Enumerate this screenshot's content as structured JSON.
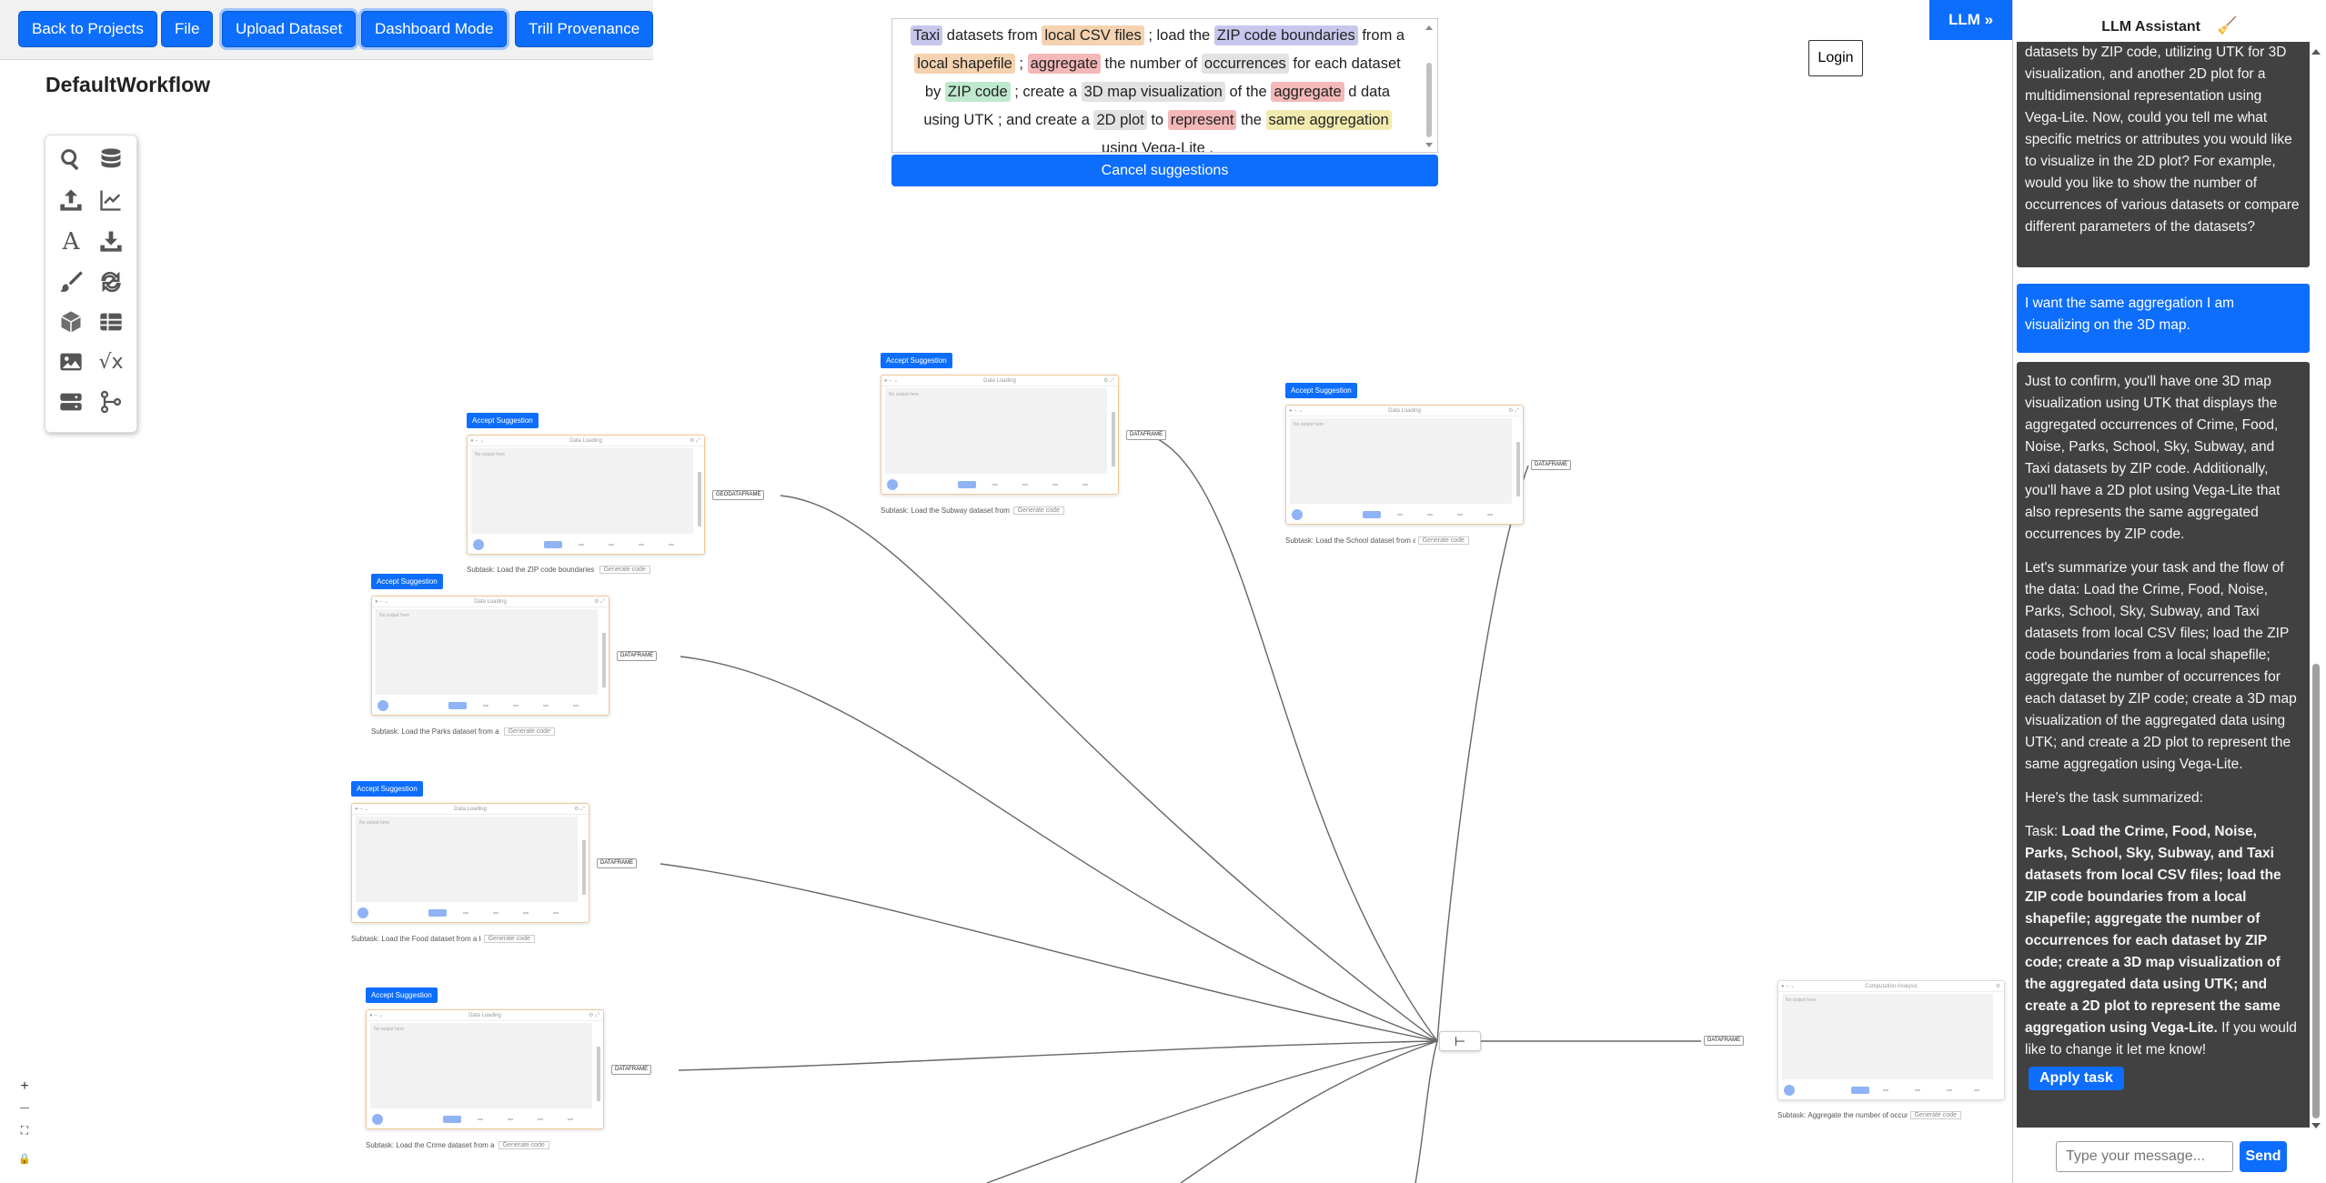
{
  "toolbar": {
    "back_label": "Back to Projects",
    "file_label": "File",
    "upload_label": "Upload Dataset",
    "dashboard_label": "Dashboard Mode",
    "provenance_label": "Trill Provenance"
  },
  "workflow_title": "DefaultWorkflow",
  "palette_icons": [
    "search-data-icon",
    "database-icon",
    "upload-icon",
    "line-chart-icon",
    "text-icon",
    "download-icon",
    "brush-icon",
    "loop-icon",
    "cube-icon",
    "table-icon",
    "image-icon",
    "formula-icon",
    "server-icon",
    "merge-flow-icon"
  ],
  "suggestion": {
    "tokens": [
      {
        "t": "Taxi",
        "c": "blue"
      },
      {
        "t": " datasets from "
      },
      {
        "t": "local CSV files",
        "c": "orange"
      },
      {
        "t": " ; load the "
      },
      {
        "t": "ZIP code boundaries",
        "c": "blue"
      },
      {
        "t": " from a "
      },
      {
        "t": "local shapefile",
        "c": "orange"
      },
      {
        "t": " ; "
      },
      {
        "t": "aggregate",
        "c": "pink"
      },
      {
        "t": " the number of "
      },
      {
        "t": "occurrences",
        "c": "gray"
      },
      {
        "t": " for each dataset by "
      },
      {
        "t": "ZIP code",
        "c": "green"
      },
      {
        "t": " ; create a "
      },
      {
        "t": "3D map visualization",
        "c": "gray"
      },
      {
        "t": " of the "
      },
      {
        "t": "aggregate",
        "c": "pink"
      },
      {
        "t": " d data using "
      },
      {
        "t": "UTK",
        "c": ""
      },
      {
        "t": " ; and create a "
      },
      {
        "t": "2D plot",
        "c": "gray"
      },
      {
        "t": " to "
      },
      {
        "t": "represent",
        "c": "pink"
      },
      {
        "t": " the "
      },
      {
        "t": "same aggregation",
        "c": "yellow"
      },
      {
        "t": " using "
      },
      {
        "t": "Vega-Lite",
        "c": ""
      },
      {
        "t": " ."
      }
    ],
    "cancel_label": "Cancel suggestions"
  },
  "login_label": "Login",
  "llm_toggle_label": "LLM »",
  "nodes": [
    {
      "id": "zip",
      "accept": "Accept Suggestion",
      "header": "Data Loading",
      "body": "No output here",
      "subtask_prefix": "Subtask:",
      "subtask": "Load the ZIP code boundaries from a local shapefile",
      "gen": "Generate code",
      "out": "GEODATAFRAME"
    },
    {
      "id": "subway",
      "accept": "Accept Suggestion",
      "header": "Data Loading",
      "body": "No output here",
      "subtask_prefix": "Subtask:",
      "subtask": "Load the Subway dataset from a local CSV file",
      "gen": "Generate code",
      "out": "DATAFRAME"
    },
    {
      "id": "school",
      "accept": "Accept Suggestion",
      "header": "Data Loading",
      "body": "No output here",
      "subtask_prefix": "Subtask:",
      "subtask": "Load the School dataset from a local CSV file",
      "gen": "Generate code",
      "out": "DATAFRAME"
    },
    {
      "id": "parks",
      "accept": "Accept Suggestion",
      "header": "Data Loading",
      "body": "No output here",
      "subtask_prefix": "Subtask:",
      "subtask": "Load the Parks dataset from a local CSV file",
      "gen": "Generate code",
      "out": "DATAFRAME"
    },
    {
      "id": "food",
      "accept": "Accept Suggestion",
      "header": "Data Loading",
      "body": "No output here",
      "subtask_prefix": "Subtask:",
      "subtask": "Load the Food dataset from a local CSV file",
      "gen": "Generate code",
      "out": "DATAFRAME"
    },
    {
      "id": "crime",
      "accept": "Accept Suggestion",
      "header": "Data Loading",
      "body": "No output here",
      "subtask_prefix": "Subtask:",
      "subtask": "Load the Crime dataset from a local CSV file",
      "gen": "Generate code",
      "out": "DATAFRAME"
    },
    {
      "id": "agg",
      "accept": "",
      "header": "Computation Analysis",
      "body": "No output here",
      "subtask_prefix": "Subtask:",
      "subtask": "Aggregate the number of occurrences",
      "gen": "Generate code",
      "out": "DATAFRAME"
    }
  ],
  "llm": {
    "title": "LLM Assistant",
    "msg1": "visualization representing the aggregated datasets by ZIP code, utilizing UTK for 3D visualization, and another 2D plot for a multidimensional representation using Vega-Lite. Now, could you tell me what specific metrics or attributes you would like to visualize in the 2D plot? For example, would you like to show the number of occurrences of various datasets or compare different parameters of the datasets?",
    "msg2": "I want the same aggregation I am visualizing on the 3D map.",
    "msg3_p1": "Just to confirm, you'll have one 3D map visualization using UTK that displays the aggregated occurrences of Crime, Food, Noise, Parks, School, Sky, Subway, and Taxi datasets by ZIP code. Additionally, you'll have a 2D plot using Vega-Lite that also represents the same aggregated occurrences by ZIP code.",
    "msg3_p2": "Let's summarize your task and the flow of the data: Load the Crime, Food, Noise, Parks, School, Sky, Subway, and Taxi datasets from local CSV files; load the ZIP code boundaries from a local shapefile; aggregate the number of occurrences for each dataset by ZIP code; create a 3D map visualization of the aggregated data using UTK; and create a 2D plot to represent the same aggregation using Vega-Lite.",
    "msg3_p3": "Here's the task summarized:",
    "msg3_task_label": "Task: ",
    "msg3_task": "Load the Crime, Food, Noise, Parks, School, Sky, Subway, and Taxi datasets from local CSV files; load the ZIP code boundaries from a local shapefile; aggregate the number of occurrences for each dataset by ZIP code; create a 3D map visualization of the aggregated data using UTK; and create a 2D plot to represent the same aggregation using Vega-Lite.",
    "msg3_tail": " If you would like to change it let me know!",
    "apply_label": "Apply task",
    "input_placeholder": "Type your message...",
    "send_label": "Send"
  },
  "zoom_controls": [
    "+",
    "—",
    "⛶",
    "🔒"
  ],
  "merge_icon": "branch-merge-icon",
  "colors": {
    "accent": "#0d6efd",
    "bot_bubble": "#414141",
    "node_border": "#f0c89a"
  }
}
